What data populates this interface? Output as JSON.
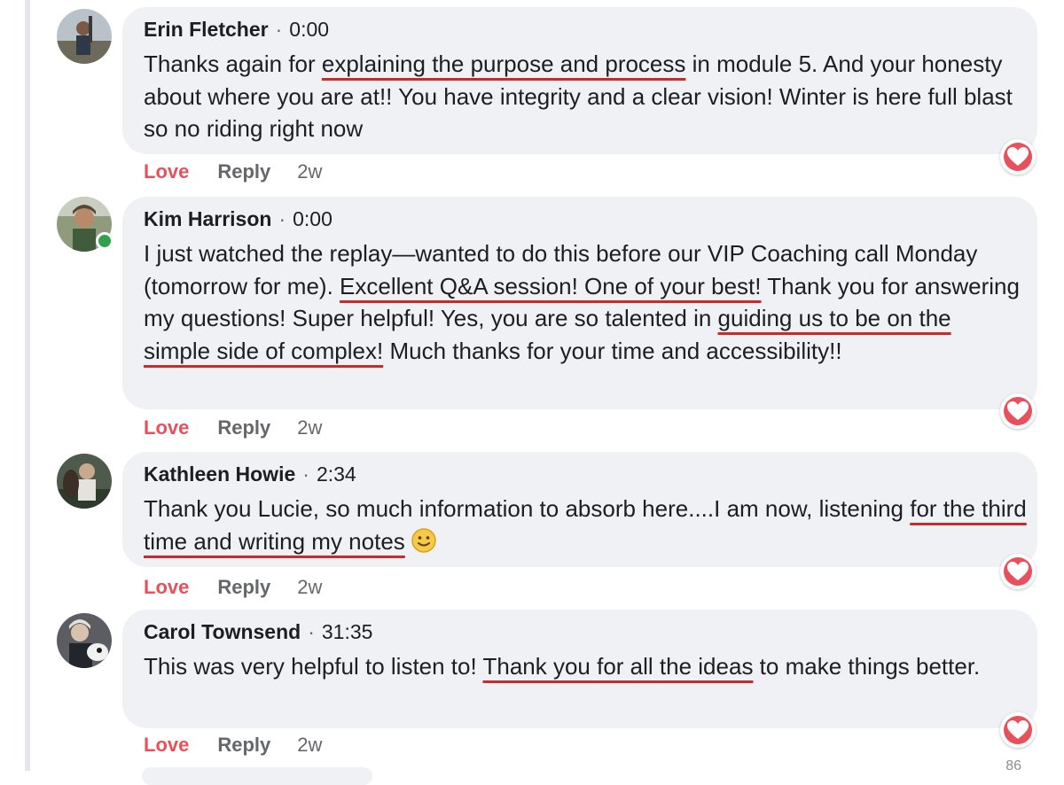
{
  "comments": [
    {
      "author": "Erin Fletcher",
      "time": "0:00",
      "text_parts": [
        {
          "t": "Thanks again for ",
          "u": false
        },
        {
          "t": "explaining the purpose and process",
          "u": true
        },
        {
          "t": " in module 5. And your honesty about where you are at!! You have integrity and a clear vision! Winter is here full blast so no riding right now",
          "u": false
        }
      ],
      "love": "Love",
      "reply": "Reply",
      "age": "2w"
    },
    {
      "author": "Kim Harrison",
      "time": "0:00",
      "text_parts": [
        {
          "t": "I just watched the replay—wanted to do this before our VIP Coaching call Monday (tomorrow for me). ",
          "u": false
        },
        {
          "t": "Excellent Q&A session! One of your best!",
          "u": true
        },
        {
          "t": " Thank you for answering my questions! Super helpful! Yes, you are so talented in ",
          "u": false
        },
        {
          "t": "guiding us to be on the simple side of complex!",
          "u": true
        },
        {
          "t": " Much thanks for your time and accessibility!!",
          "u": false
        }
      ],
      "love": "Love",
      "reply": "Reply",
      "age": "2w"
    },
    {
      "author": "Kathleen Howie",
      "time": "2:34",
      "text_parts": [
        {
          "t": "Thank you Lucie, so much information to absorb here....I am now, listening ",
          "u": false
        },
        {
          "t": "for the third time and writing my notes",
          "u": true
        }
      ],
      "love": "Love",
      "reply": "Reply",
      "age": "2w"
    },
    {
      "author": "Carol Townsend",
      "time": "31:35",
      "text_parts": [
        {
          "t": "This was very helpful to listen to! ",
          "u": false
        },
        {
          "t": "Thank you for all the ideas",
          "u": true
        },
        {
          "t": " to make things better.",
          "u": false
        }
      ],
      "love": "Love",
      "reply": "Reply",
      "age": "2w"
    }
  ],
  "page_number": "86",
  "colors": {
    "bubble": "#eff1f4",
    "love": "#e8505b",
    "underline": "#c72c2c",
    "muted": "#65676b",
    "online": "#31a24c"
  },
  "icons": {
    "reaction": "heart-icon",
    "emoji": "smiling-face-icon",
    "presence": "online-status-dot"
  }
}
